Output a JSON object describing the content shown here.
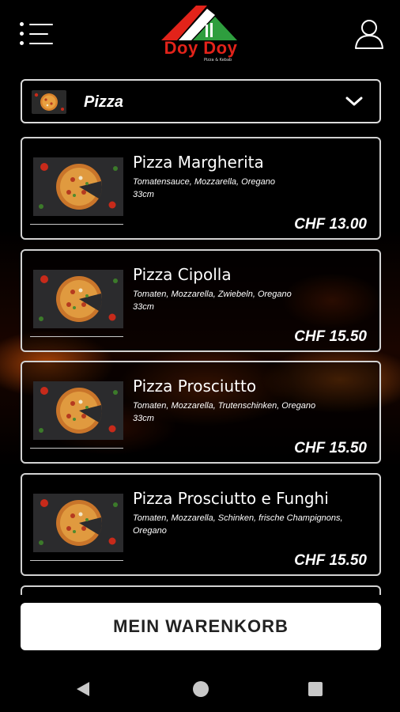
{
  "header": {
    "logo_text": "Doy Doy",
    "logo_subtitle": "Pizza & Kebab"
  },
  "category": {
    "selected": "Pizza"
  },
  "products": [
    {
      "name": "Pizza Margherita",
      "desc_line1": "Tomatensauce, Mozzarella, Oregano",
      "desc_line2": "33cm",
      "price": "CHF 13.00"
    },
    {
      "name": "Pizza Cipolla",
      "desc_line1": "Tomaten, Mozzarella, Zwiebeln, Oregano",
      "desc_line2": "33cm",
      "price": "CHF 15.50"
    },
    {
      "name": "Pizza Prosciutto",
      "desc_line1": "Tomaten, Mozzarella, Trutenschinken, Oregano",
      "desc_line2": "33cm",
      "price": "CHF 15.50"
    },
    {
      "name": "Pizza Prosciutto e Funghi",
      "desc_line1": "Tomaten, Mozzarella, Schinken, frische Champignons,",
      "desc_line2": "Oregano",
      "price": "CHF 15.50"
    }
  ],
  "cart": {
    "label": "MEIN WARENKORB"
  },
  "colors": {
    "brand_red": "#e2231a",
    "brand_green": "#2e9e3e",
    "background": "#000000"
  },
  "icons": [
    "menu-icon",
    "user-icon",
    "chevron-down-icon",
    "back-icon",
    "home-icon",
    "recent-apps-icon"
  ]
}
